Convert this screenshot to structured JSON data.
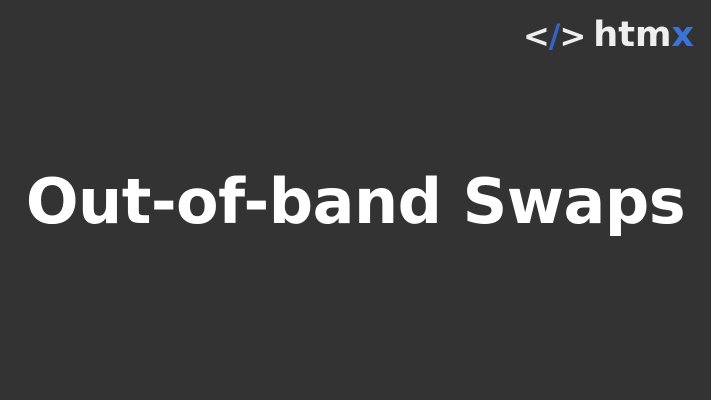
{
  "logo": {
    "mark_open": "<",
    "mark_slash": "/",
    "mark_close": ">",
    "word_main": "htm",
    "word_accent": "x",
    "colors": {
      "text": "#eeeeee",
      "accent": "#3d72d7"
    }
  },
  "title": "Out-of-band Swaps",
  "colors": {
    "background": "#333333",
    "title": "#ffffff"
  }
}
